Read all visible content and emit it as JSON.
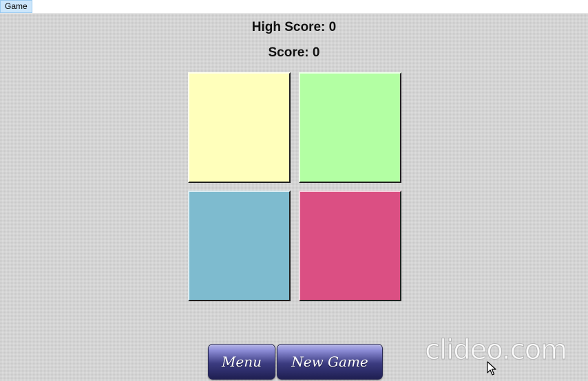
{
  "menubar": {
    "items": [
      {
        "label": "Game"
      }
    ]
  },
  "scores": {
    "high_score_text": "High Score: 0",
    "score_text": "Score: 0"
  },
  "tiles": [
    {
      "name": "yellow",
      "color": "#ffffbb"
    },
    {
      "name": "green",
      "color": "#b3ffa3"
    },
    {
      "name": "blue",
      "color": "#7ebbcf"
    },
    {
      "name": "pink",
      "color": "#db4f83"
    }
  ],
  "buttons": {
    "menu_label": "Menu",
    "new_game_label": "New Game"
  },
  "watermark": {
    "text": "clideo.com"
  },
  "icons": {
    "cursor": "mouse-pointer-icon"
  }
}
